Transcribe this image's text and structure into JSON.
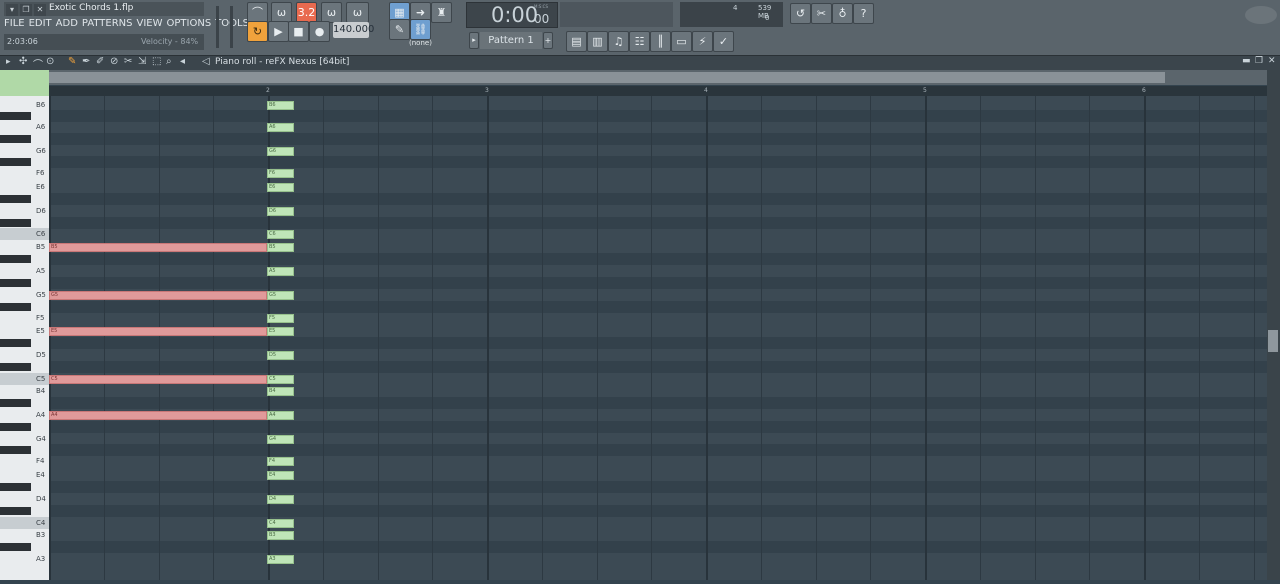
{
  "window": {
    "file_name": "Exotic Chords 1.flp",
    "menu": [
      "FILE",
      "EDIT",
      "ADD",
      "PATTERNS",
      "VIEW",
      "OPTIONS",
      "TOOLS",
      "?"
    ],
    "hint_time": "2:03:06",
    "hint_text": "Velocity - 84%"
  },
  "transport": {
    "time": "0:00",
    "time_small": "00",
    "time_unit": "M:S:CS",
    "bpm": "140.000",
    "pattern": "Pattern 1",
    "none_label": "(none)",
    "cpu": "4",
    "memory": "539 MB",
    "voices": "0",
    "record_badge": "3.2"
  },
  "piano_roll": {
    "title": "Piano roll - reFX Nexus [64bit]",
    "bars": [
      "2",
      "3",
      "4",
      "5",
      "6"
    ]
  },
  "keys": [
    "B6",
    "A6",
    "G6",
    "F6",
    "E6",
    "D6",
    "C6",
    "B5",
    "A5",
    "G5",
    "F5",
    "E5",
    "D5",
    "C5",
    "B4",
    "A4",
    "G4",
    "F4",
    "E4",
    "D4",
    "C4",
    "B3",
    "A3"
  ],
  "red_notes": [
    {
      "label": "B5",
      "row": "B5"
    },
    {
      "label": "G5",
      "row": "G5"
    },
    {
      "label": "E5",
      "row": "E5"
    },
    {
      "label": "C5",
      "row": "C5"
    },
    {
      "label": "A4",
      "row": "A4"
    }
  ],
  "green_notes": [
    "B6",
    "A6",
    "G6",
    "F6",
    "E6",
    "D6",
    "C6",
    "B5",
    "A5",
    "G5",
    "F5",
    "E5",
    "D5",
    "C5",
    "B4",
    "A4",
    "G4",
    "F4",
    "E4",
    "D4",
    "C4",
    "B3",
    "A3"
  ],
  "colors": {
    "grid_bg": "#3c4a54",
    "red_note": "#e09a9a",
    "green_note": "#bfe5b8",
    "accent_orange": "#f0a23c"
  }
}
